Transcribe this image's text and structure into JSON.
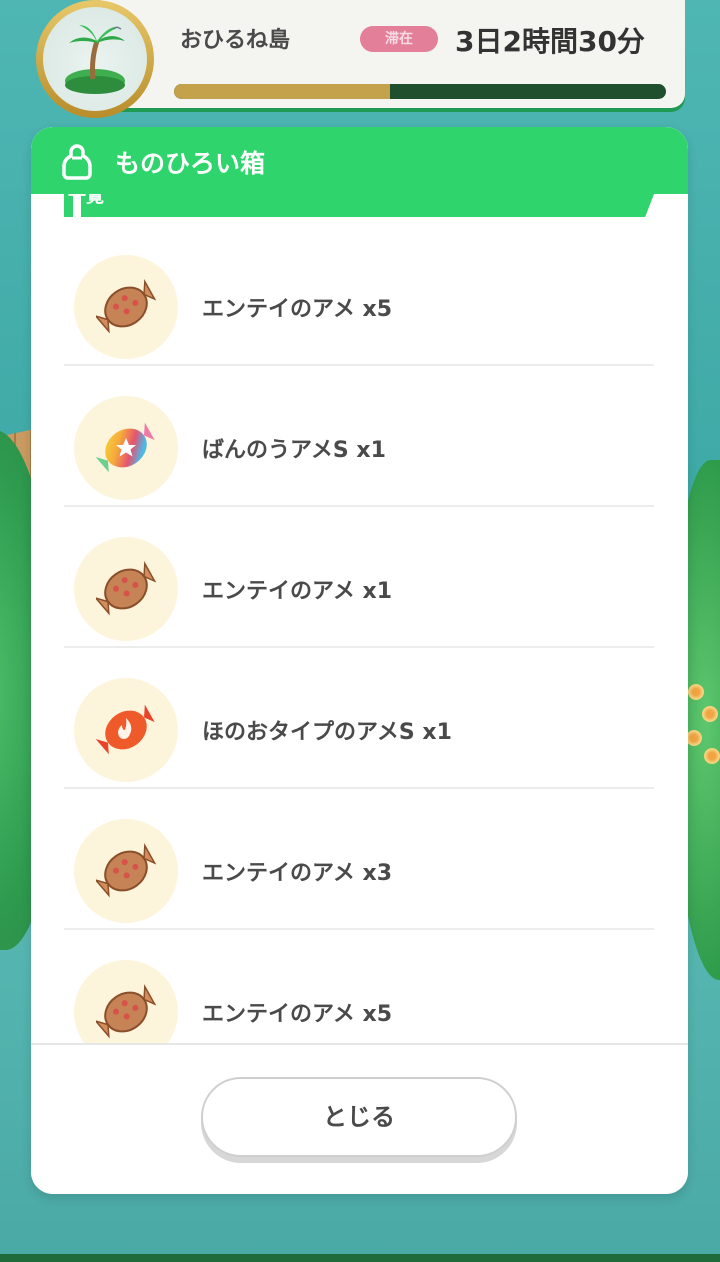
{
  "header": {
    "island_name": "おひるね島",
    "stay_badge": "滞在",
    "stay_time": "3日2時間30分",
    "progress_fraction": 0.44
  },
  "modal": {
    "title": "ものひろい箱",
    "section_label": "一覧",
    "items": [
      {
        "label": "エンテイのアメ x5",
        "icon": "entei-candy-icon"
      },
      {
        "label": "ばんのうアメS x1",
        "icon": "versatile-candy-icon"
      },
      {
        "label": "エンテイのアメ x1",
        "icon": "entei-candy-icon"
      },
      {
        "label": "ほのおタイプのアメS x1",
        "icon": "fire-candy-icon"
      },
      {
        "label": "エンテイのアメ x3",
        "icon": "entei-candy-icon"
      },
      {
        "label": "エンテイのアメ x5",
        "icon": "entei-candy-icon"
      }
    ],
    "close_label": "とじる"
  },
  "colors": {
    "accent_green": "#2fd56c",
    "progress_fill": "#c4a24b",
    "badge_pink": "#e47f9a"
  }
}
